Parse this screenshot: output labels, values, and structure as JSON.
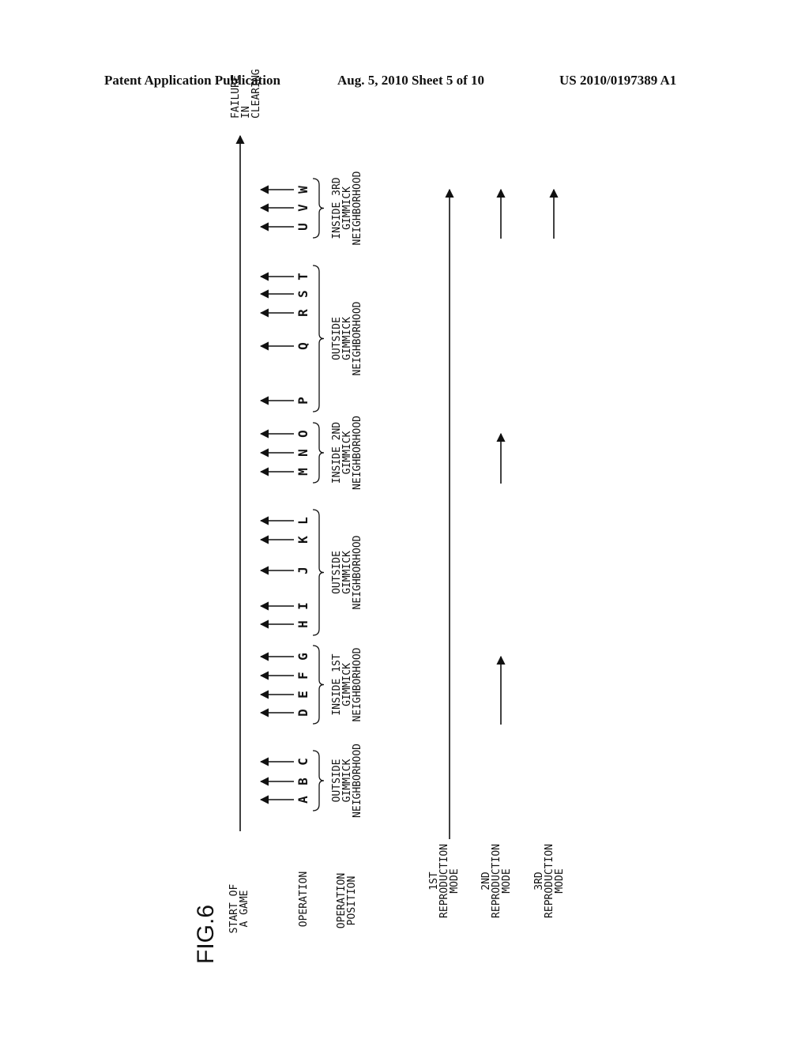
{
  "header": {
    "left": "Patent Application Publication",
    "middle": "Aug. 5, 2010   Sheet 5 of 10",
    "right": "US 2010/0197389 A1"
  },
  "figure": {
    "title": "FIG.6",
    "timeline_start": [
      "START OF",
      "A GAME"
    ],
    "timeline_end": [
      "FAILURE",
      "IN",
      "CLEARING"
    ],
    "row_labels": {
      "operation": [
        "OPERATION"
      ],
      "operation_position": [
        "OPERATION",
        "POSITION"
      ],
      "mode1": [
        "1ST",
        "REPRODUCTION",
        "MODE"
      ],
      "mode2": [
        "2ND",
        "REPRODUCTION",
        "MODE"
      ],
      "mode3": [
        "3RD",
        "REPRODUCTION",
        "MODE"
      ]
    },
    "operations": [
      "A",
      "B",
      "C",
      "D",
      "E",
      "F",
      "G",
      "H",
      "I",
      "J",
      "K",
      "L",
      "M",
      "N",
      "O",
      "P",
      "Q",
      "R",
      "S",
      "T",
      "U",
      "V",
      "W"
    ],
    "groups": [
      {
        "lines": [
          "OUTSIDE",
          "GIMMICK",
          "NEIGHBORHOOD"
        ],
        "from": "A",
        "to": "C"
      },
      {
        "lines": [
          "INSIDE 1ST",
          "GIMMICK",
          "NEIGHBORHOOD"
        ],
        "from": "D",
        "to": "G"
      },
      {
        "lines": [
          "OUTSIDE",
          "GIMMICK",
          "NEIGHBORHOOD"
        ],
        "from": "H",
        "to": "L"
      },
      {
        "lines": [
          "INSIDE 2ND",
          "GIMMICK",
          "NEIGHBORHOOD"
        ],
        "from": "M",
        "to": "O"
      },
      {
        "lines": [
          "OUTSIDE",
          "GIMMICK",
          "NEIGHBORHOOD"
        ],
        "from": "P",
        "to": "T"
      },
      {
        "lines": [
          "INSIDE 3RD",
          "GIMMICK",
          "NEIGHBORHOOD"
        ],
        "from": "U",
        "to": "W"
      }
    ],
    "reproduction_modes": [
      {
        "name": "1ST REPRODUCTION MODE",
        "segments": [
          [
            "A",
            "W"
          ]
        ]
      },
      {
        "name": "2ND REPRODUCTION MODE",
        "segments": [
          [
            "D",
            "G"
          ],
          [
            "M",
            "O"
          ],
          [
            "U",
            "W"
          ]
        ]
      },
      {
        "name": "3RD REPRODUCTION MODE",
        "segments": [
          [
            "U",
            "W"
          ]
        ]
      }
    ]
  }
}
